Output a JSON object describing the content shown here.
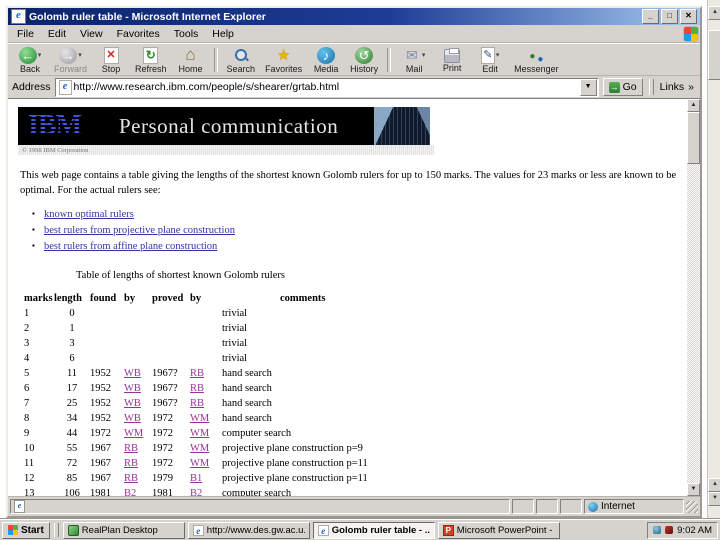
{
  "window": {
    "title": "Golomb ruler table - Microsoft Internet Explorer",
    "menu": [
      "File",
      "Edit",
      "View",
      "Favorites",
      "Tools",
      "Help"
    ],
    "toolbar": [
      {
        "label": "Back",
        "icon": "back-icon",
        "caret": true
      },
      {
        "label": "Forward",
        "icon": "forward-icon",
        "caret": true,
        "disabled": true
      },
      {
        "label": "Stop",
        "icon": "stop-icon"
      },
      {
        "label": "Refresh",
        "icon": "refresh-icon"
      },
      {
        "label": "Home",
        "icon": "home-icon"
      },
      {
        "sep": true
      },
      {
        "label": "Search",
        "icon": "search-icon"
      },
      {
        "label": "Favorites",
        "icon": "favorites-icon"
      },
      {
        "label": "Media",
        "icon": "media-icon"
      },
      {
        "label": "History",
        "icon": "history-icon"
      },
      {
        "sep": true
      },
      {
        "label": "Mail",
        "icon": "mail-icon",
        "caret": true
      },
      {
        "label": "Print",
        "icon": "print-icon"
      },
      {
        "label": "Edit",
        "icon": "edit-icon",
        "caret": true
      },
      {
        "label": "Messenger",
        "icon": "messenger-icon"
      }
    ],
    "address": {
      "label": "Address",
      "url": "http://www.research.ibm.com/people/s/shearer/grtab.html",
      "go": "Go",
      "links": "Links",
      "chevron": "»"
    },
    "status": {
      "zone": "Internet"
    }
  },
  "page": {
    "banner": {
      "logo": "IBM",
      "title": "Personal communication",
      "copyright": "© 1998 IBM Corporation"
    },
    "intro": "This web page contains a table giving the lengths of the shortest known Golomb rulers for up to 150 marks. The values for 23 marks or less are known to be optimal. For the actual rulers see:",
    "links": [
      "known optimal rulers",
      "best rulers from projective plane construction",
      "best rulers from affine plane construction"
    ],
    "table_caption": "Table of lengths of shortest known Golomb rulers",
    "table": {
      "headers": [
        "marks",
        "length",
        "found",
        "by",
        "proved",
        "by",
        "comments"
      ],
      "rows": [
        [
          "1",
          "0",
          "",
          "",
          "",
          "",
          "trivial"
        ],
        [
          "2",
          "1",
          "",
          "",
          "",
          "",
          "trivial"
        ],
        [
          "3",
          "3",
          "",
          "",
          "",
          "",
          "trivial"
        ],
        [
          "4",
          "6",
          "",
          "",
          "",
          "",
          "trivial"
        ],
        [
          "5",
          "11",
          "1952",
          "WB",
          "1967?",
          "RB",
          "hand search"
        ],
        [
          "6",
          "17",
          "1952",
          "WB",
          "1967?",
          "RB",
          "hand search"
        ],
        [
          "7",
          "25",
          "1952",
          "WB",
          "1967?",
          "RB",
          "hand search"
        ],
        [
          "8",
          "34",
          "1952",
          "WB",
          "1972",
          "WM",
          "hand search"
        ],
        [
          "9",
          "44",
          "1972",
          "WM",
          "1972",
          "WM",
          "computer search"
        ],
        [
          "10",
          "55",
          "1967",
          "RB",
          "1972",
          "WM",
          "projective plane construction p=9"
        ],
        [
          "11",
          "72",
          "1967",
          "RB",
          "1972",
          "WM",
          "projective plane construction p=11"
        ],
        [
          "12",
          "85",
          "1967",
          "RB",
          "1979",
          "B1",
          "projective plane construction p=11"
        ],
        [
          "13",
          "106",
          "1981",
          "B2",
          "1981",
          "B2",
          "computer search"
        ]
      ]
    },
    "link_color": "#993399",
    "bullet_link_color": "#3333aa"
  },
  "taskbar": {
    "start": "Start",
    "items": [
      {
        "label": "RealPlan Desktop",
        "icon": "app-icon-green",
        "active": false
      },
      {
        "label": "http://www.des.gw.ac.u...",
        "icon": "ie-icon",
        "active": false
      },
      {
        "label": "Golomb ruler table - ...",
        "icon": "ie-icon",
        "active": true
      },
      {
        "label": "Microsoft PowerPoint - [...",
        "icon": "powerpoint-icon",
        "active": false
      }
    ],
    "clock": "9:02 AM"
  }
}
